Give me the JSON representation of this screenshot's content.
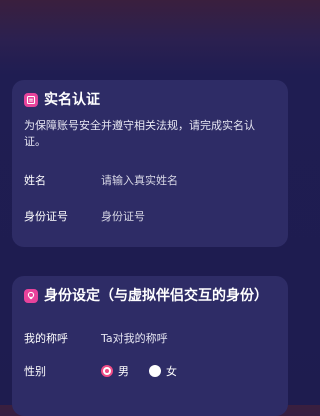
{
  "verify_card": {
    "title": "实名认证",
    "notice": "为保障账号安全并遵守相关法规，请完成实名认证。",
    "name_label": "姓名",
    "name_placeholder": "请输入真实姓名",
    "id_label": "身份证号",
    "id_placeholder": "身份证号"
  },
  "identity_card": {
    "title": "身份设定（与虚拟伴侣交互的身份）",
    "nickname_label": "我的称呼",
    "nickname_value": "Ta对我的称呼",
    "gender_label": "性别",
    "gender_options": [
      {
        "label": "男",
        "selected": true
      },
      {
        "label": "女",
        "selected": false
      }
    ]
  },
  "colors": {
    "accent": "#f04c86",
    "card": "#2e2c66",
    "background": "#1e1c4f"
  }
}
